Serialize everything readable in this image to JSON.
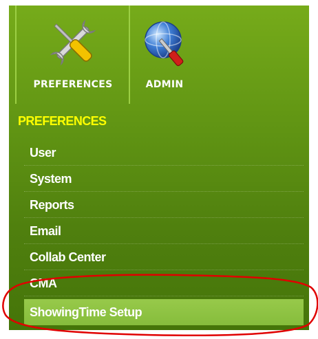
{
  "toolbar": {
    "items": [
      {
        "label": "PREFERENCES",
        "icon": "tools-icon"
      },
      {
        "label": "ADMIN",
        "icon": "admin-globe-icon"
      }
    ]
  },
  "section": {
    "title": "PREFERENCES"
  },
  "menu": {
    "items": [
      {
        "label": "User"
      },
      {
        "label": "System"
      },
      {
        "label": "Reports"
      },
      {
        "label": "Email"
      },
      {
        "label": "Collab Center"
      },
      {
        "label": "CMA"
      },
      {
        "label": "ShowingTime Setup"
      }
    ],
    "active_index": 6
  },
  "colors": {
    "panel_green": "#5f9313",
    "section_title": "#ffff00",
    "active_item": "#8bc34a",
    "annotation_red": "#e00000"
  }
}
